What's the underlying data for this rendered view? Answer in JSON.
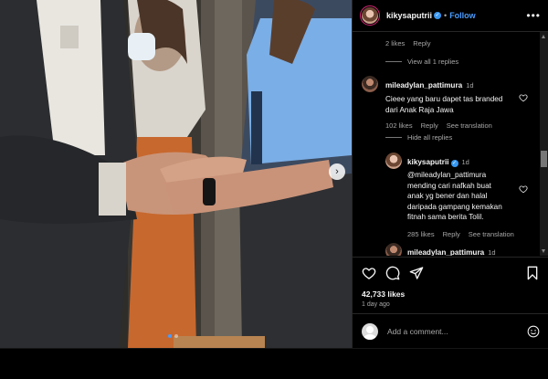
{
  "header": {
    "username": "kikysaputrii",
    "separator": "•",
    "follow_label": "Follow",
    "more_icon": "more-horizontal-icon"
  },
  "thread": {
    "top_reply_meta": {
      "likes": "2 likes",
      "reply": "Reply"
    },
    "view_replies": "View all 1 replies",
    "comment1": {
      "username": "mileadylan_pattimura",
      "time": "1d",
      "text_line1": "Cieee yang baru dapet tas branded",
      "text_line2": "dari Anak Raja Jawa",
      "likes": "102 likes",
      "reply": "Reply",
      "translate": "See translation"
    },
    "hide_replies": "Hide all replies",
    "reply1": {
      "username": "kikysaputrii",
      "time": "1d",
      "text_line1": "@mileadylan_pattimura",
      "text_line2": "mending cari nafkah buat",
      "text_line3": "anak yg bener dan halal",
      "text_line4": "daripada gampang kemakan",
      "text_line5": "fitnah sama berita Tolil.",
      "likes": "285 likes",
      "reply": "Reply",
      "translate": "See translation"
    },
    "reply2": {
      "username": "mileadylan_pattimura",
      "time": "1d"
    }
  },
  "actions": {
    "likes_count": "42,733 likes",
    "date": "1 day ago"
  },
  "add_comment": {
    "placeholder": "Add a comment..."
  },
  "carousel": {
    "slide_count": 2,
    "active_index": 0
  },
  "colors": {
    "accent": "#4a9cff",
    "verified": "#3897f0",
    "background": "#000000",
    "muted_text": "#a8a8a8"
  }
}
